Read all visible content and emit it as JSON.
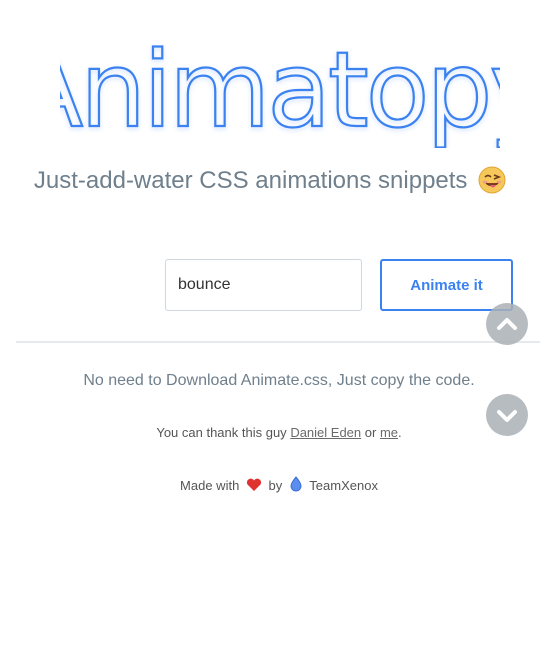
{
  "logo": {
    "text": "Animatopy"
  },
  "tagline": {
    "text": "Just-add-water CSS animations snippets",
    "emoji": "winking-tongue-face-icon"
  },
  "search": {
    "value": "bounce",
    "button_label": "Animate it"
  },
  "nav": {
    "up": "chevron-up-icon",
    "down": "chevron-down-icon"
  },
  "note": {
    "text": "No need to Download Animate.css, Just copy the code."
  },
  "credits": {
    "prefix": "You can thank this guy",
    "author_link": "Daniel Eden",
    "middle": "or",
    "me_link": "me",
    "suffix": "."
  },
  "footer": {
    "made_with": "Made with",
    "heart": "heart-icon",
    "by": "by",
    "drop": "drop-icon",
    "team": "TeamXenox"
  },
  "colors": {
    "logo_stroke": "#3b82f0",
    "accent": "#3b82f0",
    "text_muted": "#6f7f8c"
  }
}
